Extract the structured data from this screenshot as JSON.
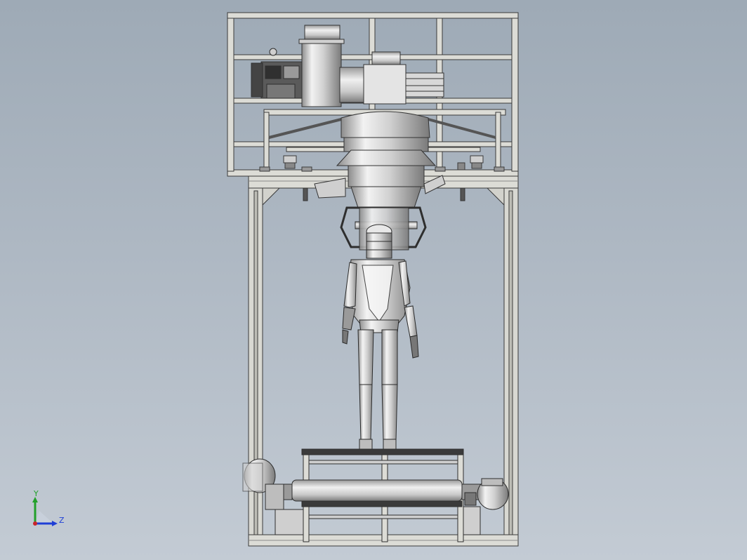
{
  "viewport": {
    "background_top": "#9eaab6",
    "background_bottom": "#c3cbd4"
  },
  "triad": {
    "y_label": "Y",
    "z_label": "Z",
    "y_color": "#22a02a",
    "z_color": "#1f3fd6",
    "x_color": "#c8242a"
  },
  "model": {
    "colors": {
      "frame": "#dcdcd6",
      "frame_edge": "#3a3a3a",
      "metal_light": "#e6e6e6",
      "metal_dark": "#6e6e6e",
      "motor_dark": "#4a4a4a"
    }
  }
}
